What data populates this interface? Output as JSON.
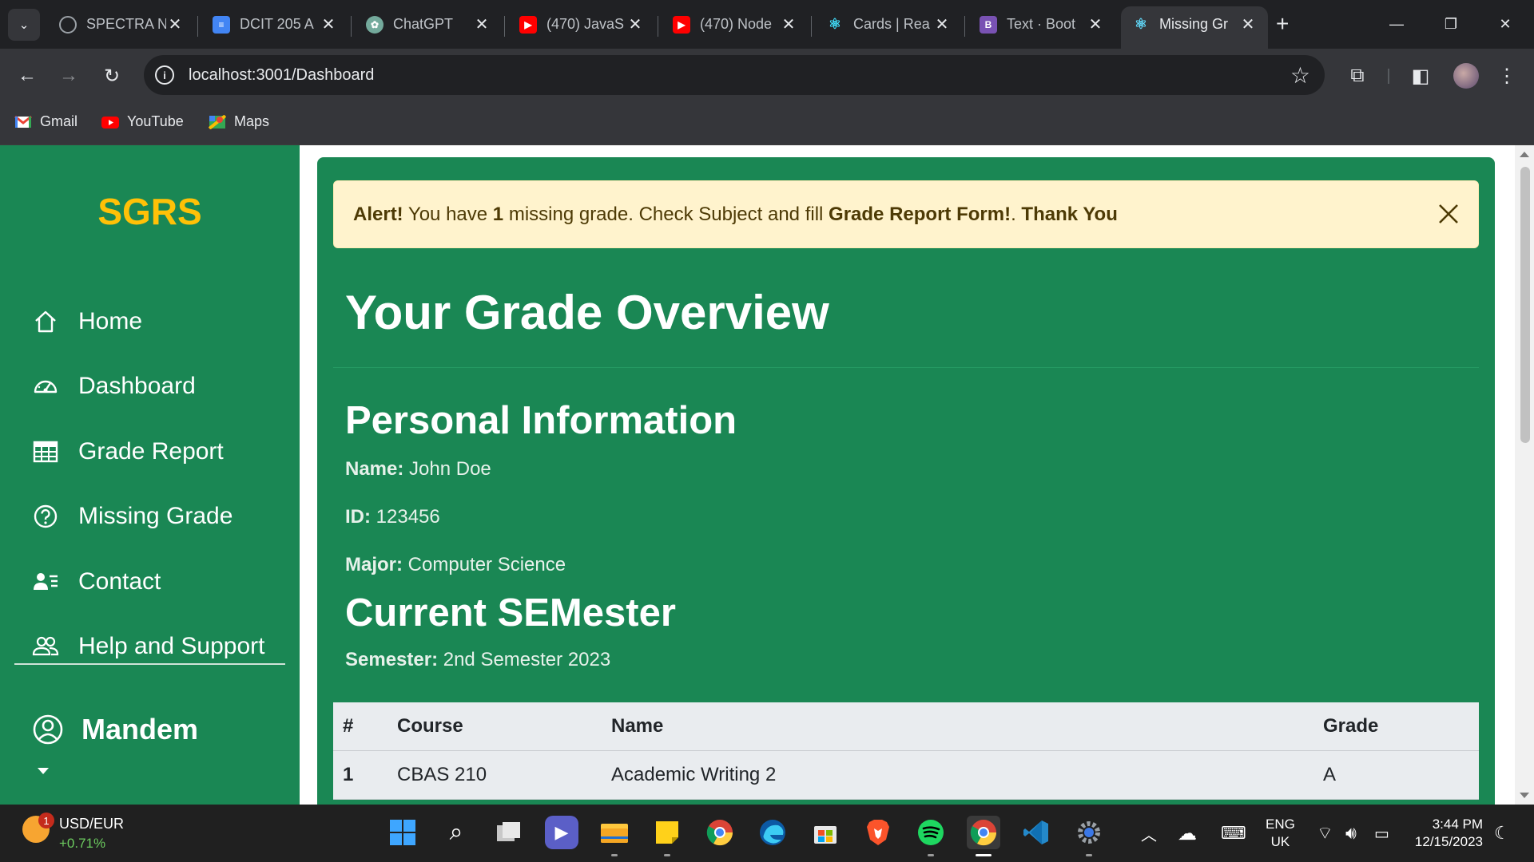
{
  "browser": {
    "tabs": [
      {
        "label": "SPECTRA N",
        "favicon": "spectra-icon",
        "color": "#5f6368",
        "active": false
      },
      {
        "label": "DCIT 205 A",
        "favicon": "docs-icon",
        "color": "#4285f4",
        "active": false
      },
      {
        "label": "ChatGPT",
        "favicon": "chatgpt-icon",
        "color": "#74aa9c",
        "active": false
      },
      {
        "label": "(470) JavaS",
        "favicon": "youtube-icon",
        "color": "#ff0000",
        "active": false
      },
      {
        "label": "(470) Node",
        "favicon": "youtube-icon",
        "color": "#ff0000",
        "active": false
      },
      {
        "label": "Cards | Rea",
        "favicon": "react-bootstrap-icon",
        "color": "#41e0fd",
        "active": false
      },
      {
        "label": "Text · Boot",
        "favicon": "bootstrap-icon",
        "color": "#7952b3",
        "active": false
      },
      {
        "label": "Missing Gr",
        "favicon": "react-icon",
        "color": "#61dafb",
        "active": true
      }
    ],
    "url": "localhost:3001/Dashboard",
    "bookmarks": [
      {
        "label": "Gmail",
        "icon": "gmail-icon"
      },
      {
        "label": "YouTube",
        "icon": "youtube-icon"
      },
      {
        "label": "Maps",
        "icon": "maps-icon"
      }
    ]
  },
  "sidebar": {
    "brand": "SGRS",
    "items": [
      {
        "label": "Home",
        "icon": "home-icon"
      },
      {
        "label": "Dashboard",
        "icon": "speedometer-icon"
      },
      {
        "label": "Grade Report",
        "icon": "table-icon"
      },
      {
        "label": "Missing Grade",
        "icon": "question-circle-icon"
      },
      {
        "label": "Contact",
        "icon": "person-lines-icon"
      },
      {
        "label": "Help and Support",
        "icon": "people-icon"
      }
    ],
    "user": "Mandem"
  },
  "alert": {
    "prefix": "Alert!",
    "text1": " You have ",
    "count": "1",
    "text2": " missing grade. Check Subject and fill ",
    "form": "Grade Report Form!",
    "text3": ". ",
    "thanks": "Thank You"
  },
  "main": {
    "title": "Your Grade Overview",
    "personal_heading": "Personal Information",
    "name_label": "Name:",
    "name_value": " John Doe",
    "id_label": "ID:",
    "id_value": " 123456",
    "major_label": "Major:",
    "major_value": " Computer Science",
    "semester_heading": "Current SEMester",
    "semester_label": "Semester:",
    "semester_value": " 2nd Semester 2023"
  },
  "table": {
    "headers": [
      "#",
      "Course",
      "Name",
      "Grade"
    ],
    "rows": [
      [
        "1",
        "CBAS 210",
        "Academic Writing 2",
        "A"
      ]
    ]
  },
  "taskbar": {
    "widget_title": "USD/EUR",
    "widget_change": "+0.71%",
    "widget_badge": "1",
    "lang": "ENG",
    "region": "UK",
    "time": "3:44 PM",
    "date": "12/15/2023"
  },
  "colors": {
    "primary_green": "#1a8754",
    "brand_yellow": "#ffc107",
    "alert_bg": "#fff3cd"
  }
}
